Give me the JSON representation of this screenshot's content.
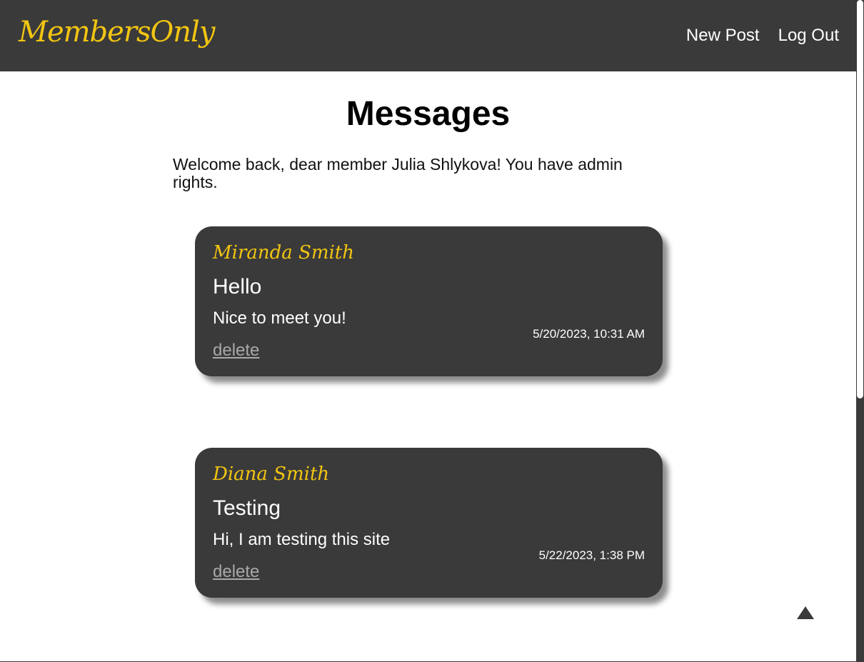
{
  "navbar": {
    "logo": "MembersOnly",
    "links": [
      "New Post",
      "Log Out"
    ]
  },
  "page": {
    "title": "Messages",
    "welcome": "Welcome back, dear member Julia Shlykova! You have admin rights."
  },
  "messages": [
    {
      "author": "Miranda Smith",
      "title": "Hello",
      "body": "Nice to meet you!",
      "timestamp": "5/20/2023, 10:31 AM",
      "delete_label": "delete"
    },
    {
      "author": "Diana Smith",
      "title": "Testing",
      "body": "Hi, I am testing this site",
      "timestamp": "5/22/2023, 1:38 PM",
      "delete_label": "delete"
    }
  ],
  "icons": {
    "scroll_top": "arrow-up-icon"
  },
  "colors": {
    "dark": "#3a3a3a",
    "accent": "#f2c511",
    "link_muted": "#a8a8a8"
  }
}
